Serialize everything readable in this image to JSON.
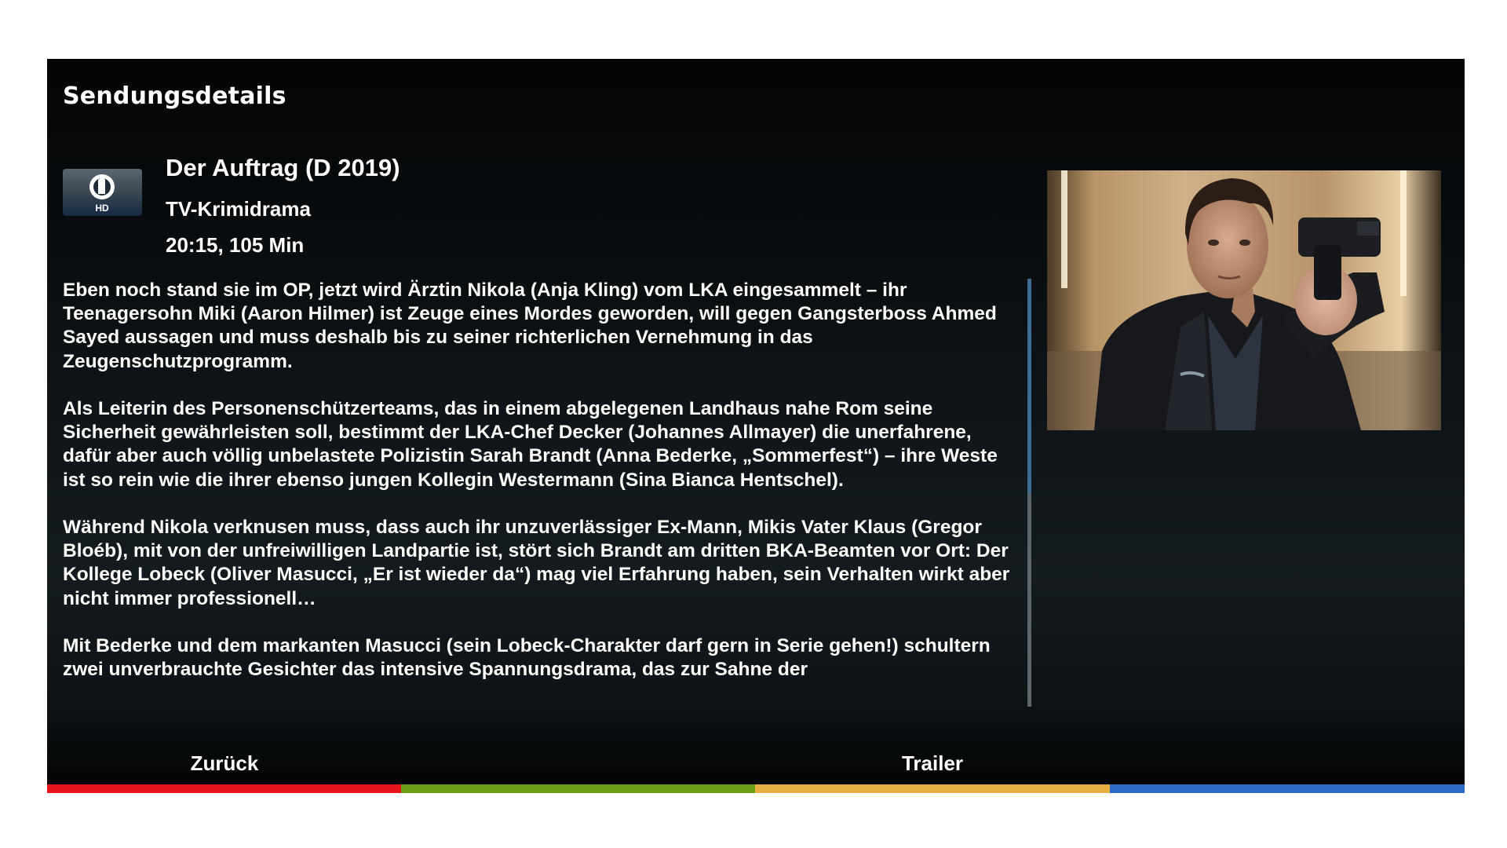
{
  "panel": {
    "title": "Sendungsdetails"
  },
  "channel": {
    "logo_icon": "das-erste-logo-icon",
    "logo_text": "HD"
  },
  "program": {
    "title": "Der Auftrag (D 2019)",
    "genre": "TV-Krimidrama",
    "time_duration": "20:15, 105 Min"
  },
  "description": {
    "paragraphs": [
      "Eben noch stand sie im OP, jetzt wird Ärztin Nikola (Anja Kling) vom LKA eingesammelt – ihr Teenagersohn Miki (Aaron Hilmer) ist Zeuge eines Mordes geworden, will gegen Gangsterboss Ahmed Sayed aussagen und muss deshalb bis zu seiner richterlichen Vernehmung in das Zeugenschutzprogramm.",
      "Als Leiterin des Personenschützerteams, das in einem abgelegenen Landhaus nahe Rom seine Sicherheit gewährleisten soll, bestimmt der LKA-Chef Decker (Johannes Allmayer) die unerfahrene, dafür aber auch völlig unbelastete Polizistin Sarah Brandt (Anna Bederke, „Sommerfest“) – ihre Weste ist so rein wie die ihrer ebenso jungen Kollegin Westermann (Sina Bianca Hentschel).",
      "Während Nikola verknusen muss, dass auch ihr unzuverlässiger Ex-Mann, Mikis Vater Klaus (Gregor Bloéb), mit von der unfreiwilligen Landpartie ist, stört sich Brandt am dritten BKA-Beamten vor Ort: Der Kollege Lobeck (Oliver Masucci, „Er ist wieder da“) mag viel Erfahrung haben, sein Verhalten wirkt aber nicht immer professionell…",
      "Mit Bederke und dem markanten Masucci (sein Lobeck-Charakter darf gern in Serie gehen!) schultern zwei unverbrauchte Gesichter das intensive Spannungsdrama, das zur Sahne der"
    ],
    "scroll_fraction": 0.5
  },
  "footer": {
    "buttons": [
      {
        "label": "Zurück",
        "color": "#e8141b",
        "name": "red"
      },
      {
        "label": "",
        "color": "#6a9e14",
        "name": "green"
      },
      {
        "label": "Trailer",
        "color": "#e6b040",
        "name": "yellow"
      },
      {
        "label": "",
        "color": "#2e6bc9",
        "name": "blue"
      }
    ]
  }
}
